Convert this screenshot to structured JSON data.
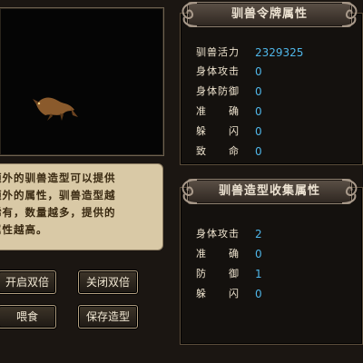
{
  "preview": {
    "creature": "beast-sprite"
  },
  "description": {
    "lines": [
      "额外的驯兽造型可以提供",
      "额外的属性，驯兽造型越",
      "稀有，数量越多，提供的",
      "属性越高。"
    ]
  },
  "buttons": {
    "enable_double": "开启双倍",
    "disable_double": "关闭双倍",
    "feed": "喂食",
    "save_model": "保存造型"
  },
  "token_attributes": {
    "title": "驯兽令牌属性",
    "rows": [
      {
        "label": "驯兽活力",
        "value": "2329325"
      },
      {
        "label": "身体攻击",
        "value": "0"
      },
      {
        "label": "身体防御",
        "value": "0"
      },
      {
        "label": "准　　确",
        "value": "0"
      },
      {
        "label": "躲　　闪",
        "value": "0"
      },
      {
        "label": "致　　命",
        "value": "0"
      }
    ]
  },
  "collection_attributes": {
    "title": "驯兽造型收集属性",
    "rows": [
      {
        "label": "身体攻击",
        "value": "2"
      },
      {
        "label": "准　　确",
        "value": "0"
      },
      {
        "label": "防　　御",
        "value": "1"
      },
      {
        "label": "躲　　闪",
        "value": "0"
      }
    ]
  },
  "colors": {
    "value_blue": "#4fb6e8",
    "label_cream": "#efe4cf",
    "panel_bg": "#14110e"
  }
}
